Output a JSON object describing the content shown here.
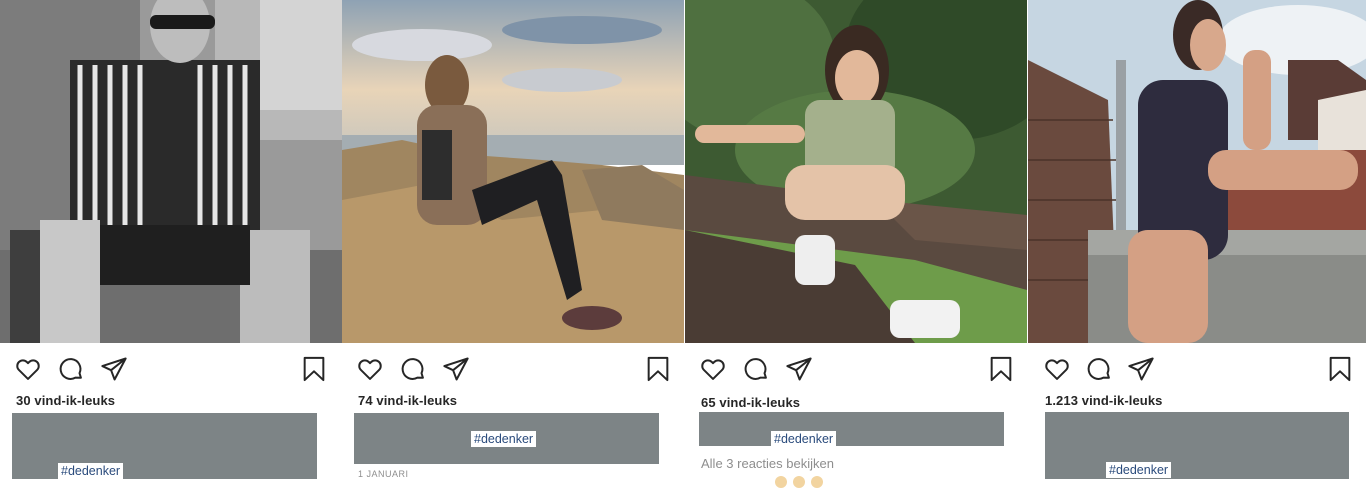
{
  "posts": [
    {
      "likes": "30 vind-ik-leuks",
      "hashtag": "#dedenker"
    },
    {
      "likes": "74 vind-ik-leuks",
      "hashtag": "#dedenker",
      "date": "1 JANUARI"
    },
    {
      "likes": "65 vind-ik-leuks",
      "hashtag": "#dedenker",
      "comments": "Alle 3 reacties bekijken"
    },
    {
      "likes": "1.213 vind-ik-leuks",
      "hashtag": "#dedenker"
    }
  ],
  "icons": [
    "heart-icon",
    "comment-icon",
    "share-icon",
    "bookmark-icon"
  ],
  "colors": {
    "caption_block": "#7d8486",
    "hashtag_text": "#2a4b7c",
    "meta_text": "#8e8e8e"
  }
}
